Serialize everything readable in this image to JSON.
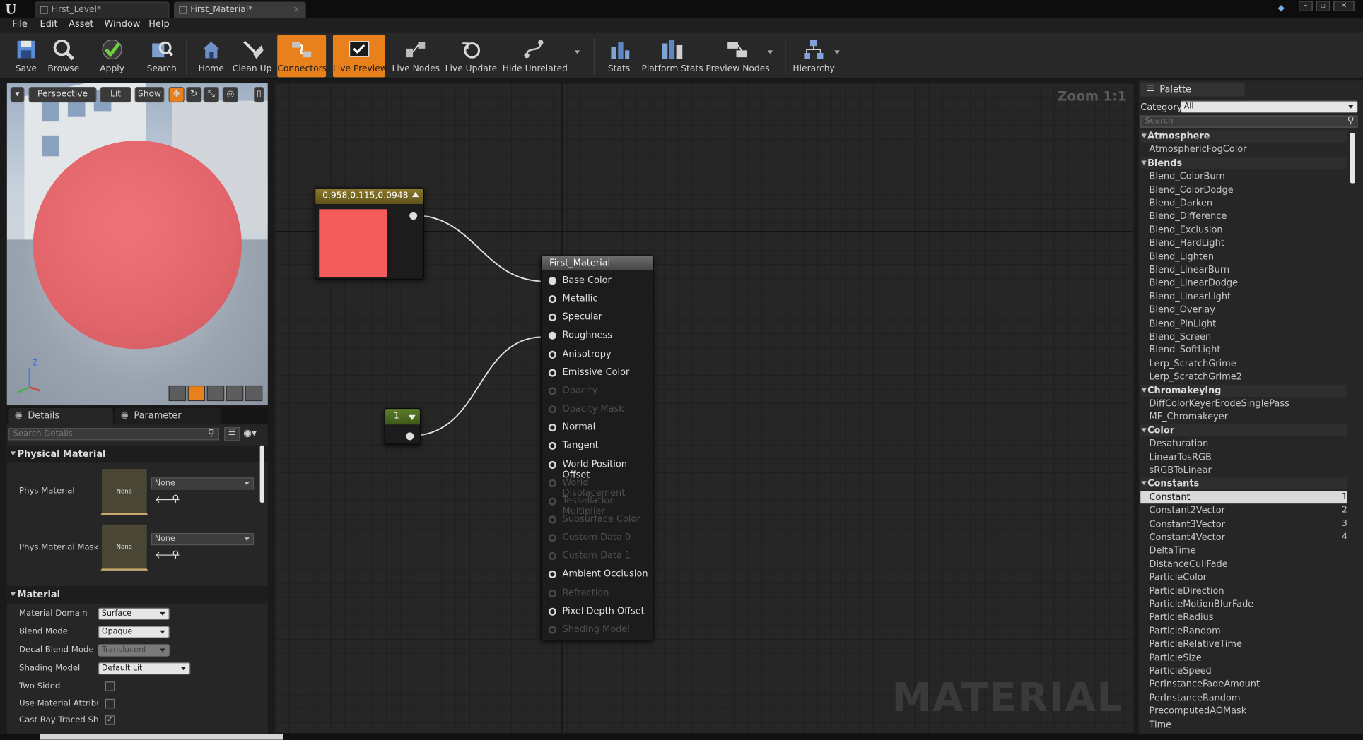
{
  "window": {
    "tabs": [
      {
        "label": "First_Level*"
      },
      {
        "label": "First_Material*"
      }
    ]
  },
  "menu": {
    "items": [
      "File",
      "Edit",
      "Asset",
      "Window",
      "Help"
    ]
  },
  "toolbar": {
    "buttons": [
      {
        "label": "Save",
        "icon": "save-icon",
        "active": false
      },
      {
        "label": "Browse",
        "icon": "browse-icon",
        "active": false
      },
      {
        "label": "Apply",
        "icon": "apply-checkmark-icon",
        "active": false
      },
      {
        "label": "Search",
        "icon": "search-icon",
        "active": false
      },
      {
        "label": "Home",
        "icon": "home-icon",
        "active": false
      },
      {
        "label": "Clean Up",
        "icon": "clean-up-icon",
        "active": false
      },
      {
        "label": "Connectors",
        "icon": "connectors-icon",
        "active": true
      },
      {
        "label": "Live Preview",
        "icon": "live-preview-icon",
        "active": true
      },
      {
        "label": "Live Nodes",
        "icon": "live-nodes-icon",
        "active": false
      },
      {
        "label": "Live Update",
        "icon": "live-update-icon",
        "active": false
      },
      {
        "label": "Hide Unrelated",
        "icon": "hide-unrelated-icon",
        "active": false
      },
      {
        "label": "Stats",
        "icon": "stats-icon",
        "active": false
      },
      {
        "label": "Platform Stats",
        "icon": "platform-stats-icon",
        "active": false
      },
      {
        "label": "Preview Nodes",
        "icon": "preview-nodes-icon",
        "active": false
      },
      {
        "label": "Hierarchy",
        "icon": "hierarchy-icon",
        "active": false
      }
    ],
    "accent": "#e8801c"
  },
  "viewport": {
    "perspective_label": "Perspective",
    "lit_label": "Lit",
    "show_label": "Show",
    "axis_label": "Z",
    "sphere_color": "#e8696e"
  },
  "details_panel": {
    "tab_details": "Details",
    "tab_params": "Parameter Defaults",
    "search_placeholder": "Search Details",
    "physical_material_section": "Physical Material",
    "phys_material_label": "Phys Material",
    "phys_material_value": "None",
    "phys_material_thumb": "None",
    "phys_material_mask_label": "Phys Material Mask",
    "phys_material_mask_value": "None",
    "phys_material_mask_thumb": "None",
    "material_section": "Material",
    "properties": [
      {
        "label": "Material Domain",
        "value": "Surface"
      },
      {
        "label": "Blend Mode",
        "value": "Opaque"
      },
      {
        "label": "Decal Blend Mode",
        "value": "Translucent"
      },
      {
        "label": "Shading Model",
        "value": "Default Lit"
      },
      {
        "label": "Two Sided",
        "checked": false
      },
      {
        "label": "Use Material Attributes",
        "checked": false
      },
      {
        "label": "Cast Ray Traced Shadows",
        "checked": true
      }
    ]
  },
  "graph": {
    "zoom_label": "Zoom 1:1",
    "watermark": "MATERIAL",
    "color_node": {
      "title": "0.958,0.115,0.0948",
      "swatch": "#f45c5c"
    },
    "constant_node": {
      "value": "1"
    },
    "material_node": {
      "title": "First_Material",
      "inputs": [
        {
          "label": "Base Color",
          "enabled": true,
          "connected": true
        },
        {
          "label": "Metallic",
          "enabled": true,
          "connected": false
        },
        {
          "label": "Specular",
          "enabled": true,
          "connected": false
        },
        {
          "label": "Roughness",
          "enabled": true,
          "connected": true
        },
        {
          "label": "Anisotropy",
          "enabled": true,
          "connected": false
        },
        {
          "label": "Emissive Color",
          "enabled": true,
          "connected": false
        },
        {
          "label": "Opacity",
          "enabled": false,
          "connected": false
        },
        {
          "label": "Opacity Mask",
          "enabled": false,
          "connected": false
        },
        {
          "label": "Normal",
          "enabled": true,
          "connected": false
        },
        {
          "label": "Tangent",
          "enabled": true,
          "connected": false
        },
        {
          "label": "World Position Offset",
          "enabled": true,
          "connected": false
        },
        {
          "label": "World Displacement",
          "enabled": false,
          "connected": false
        },
        {
          "label": "Tessellation Multiplier",
          "enabled": false,
          "connected": false
        },
        {
          "label": "Subsurface Color",
          "enabled": false,
          "connected": false
        },
        {
          "label": "Custom Data 0",
          "enabled": false,
          "connected": false
        },
        {
          "label": "Custom Data 1",
          "enabled": false,
          "connected": false
        },
        {
          "label": "Ambient Occlusion",
          "enabled": true,
          "connected": false
        },
        {
          "label": "Refraction",
          "enabled": false,
          "connected": false
        },
        {
          "label": "Pixel Depth Offset",
          "enabled": true,
          "connected": false
        },
        {
          "label": "Shading Model",
          "enabled": false,
          "connected": false
        }
      ]
    }
  },
  "palette": {
    "tab_label": "Palette",
    "category_label": "Category:",
    "category_value": "All",
    "search_placeholder": "Search",
    "entries": [
      {
        "kind": "cat",
        "label": "Atmosphere"
      },
      {
        "kind": "item",
        "label": "AtmosphericFogColor"
      },
      {
        "kind": "cat",
        "label": "Blends"
      },
      {
        "kind": "item",
        "label": "Blend_ColorBurn"
      },
      {
        "kind": "item",
        "label": "Blend_ColorDodge"
      },
      {
        "kind": "item",
        "label": "Blend_Darken"
      },
      {
        "kind": "item",
        "label": "Blend_Difference"
      },
      {
        "kind": "item",
        "label": "Blend_Exclusion"
      },
      {
        "kind": "item",
        "label": "Blend_HardLight"
      },
      {
        "kind": "item",
        "label": "Blend_Lighten"
      },
      {
        "kind": "item",
        "label": "Blend_LinearBurn"
      },
      {
        "kind": "item",
        "label": "Blend_LinearDodge"
      },
      {
        "kind": "item",
        "label": "Blend_LinearLight"
      },
      {
        "kind": "item",
        "label": "Blend_Overlay"
      },
      {
        "kind": "item",
        "label": "Blend_PinLight"
      },
      {
        "kind": "item",
        "label": "Blend_Screen"
      },
      {
        "kind": "item",
        "label": "Blend_SoftLight"
      },
      {
        "kind": "item",
        "label": "Lerp_ScratchGrime"
      },
      {
        "kind": "item",
        "label": "Lerp_ScratchGrime2"
      },
      {
        "kind": "cat",
        "label": "Chromakeying"
      },
      {
        "kind": "item",
        "label": "DiffColorKeyerErodeSinglePass"
      },
      {
        "kind": "item",
        "label": "MF_Chromakeyer"
      },
      {
        "kind": "cat",
        "label": "Color"
      },
      {
        "kind": "item",
        "label": "Desaturation"
      },
      {
        "kind": "item",
        "label": "LinearTosRGB"
      },
      {
        "kind": "item",
        "label": "sRGBToLinear"
      },
      {
        "kind": "cat",
        "label": "Constants"
      },
      {
        "kind": "item",
        "label": "Constant",
        "hotkey": "1",
        "selected": true
      },
      {
        "kind": "item",
        "label": "Constant2Vector",
        "hotkey": "2"
      },
      {
        "kind": "item",
        "label": "Constant3Vector",
        "hotkey": "3"
      },
      {
        "kind": "item",
        "label": "Constant4Vector",
        "hotkey": "4"
      },
      {
        "kind": "item",
        "label": "DeltaTime"
      },
      {
        "kind": "item",
        "label": "DistanceCullFade"
      },
      {
        "kind": "item",
        "label": "ParticleColor"
      },
      {
        "kind": "item",
        "label": "ParticleDirection"
      },
      {
        "kind": "item",
        "label": "ParticleMotionBlurFade"
      },
      {
        "kind": "item",
        "label": "ParticleRadius"
      },
      {
        "kind": "item",
        "label": "ParticleRandom"
      },
      {
        "kind": "item",
        "label": "ParticleRelativeTime"
      },
      {
        "kind": "item",
        "label": "ParticleSize"
      },
      {
        "kind": "item",
        "label": "ParticleSpeed"
      },
      {
        "kind": "item",
        "label": "PerInstanceFadeAmount"
      },
      {
        "kind": "item",
        "label": "PerInstanceRandom"
      },
      {
        "kind": "item",
        "label": "PrecomputedAOMask"
      },
      {
        "kind": "item",
        "label": "Time"
      }
    ]
  }
}
